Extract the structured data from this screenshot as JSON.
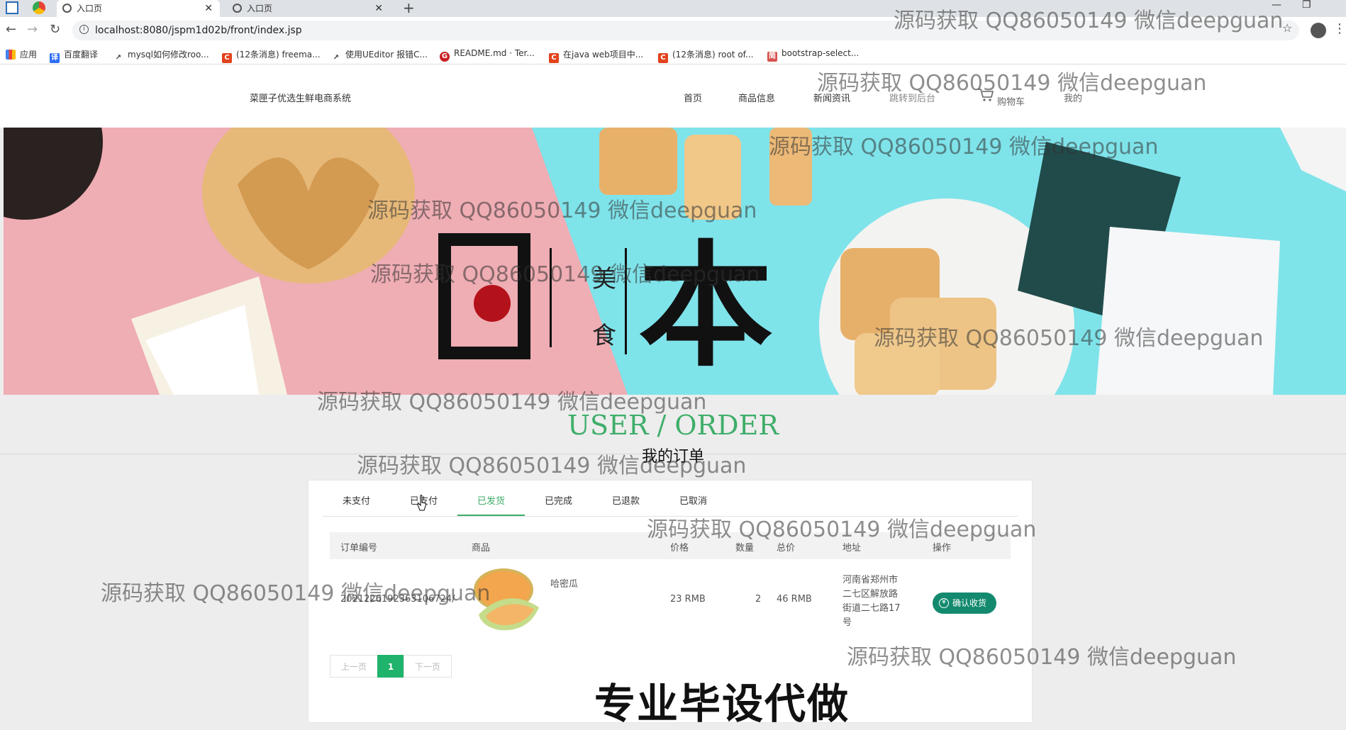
{
  "browser": {
    "tabs": [
      {
        "title": "入口页",
        "active": true
      },
      {
        "title": "入口页",
        "active": false
      }
    ],
    "url": "localhost:8080/jspm1d02b/front/index.jsp",
    "bookmarks": [
      {
        "label": "应用",
        "icon": "apps-grid-icon"
      },
      {
        "label": "百度翻译",
        "icon": "baidu-translate-icon"
      },
      {
        "label": "mysql如何修改roo...",
        "icon": "bookmark-link-icon"
      },
      {
        "label": "(12条消息) freema...",
        "icon": "csdn-icon"
      },
      {
        "label": "使用UEditor 报错C...",
        "icon": "bookmark-link-icon"
      },
      {
        "label": "README.md · Ter...",
        "icon": "gitee-icon"
      },
      {
        "label": "在java web项目中...",
        "icon": "csdn-icon"
      },
      {
        "label": "(12条消息) root of...",
        "icon": "csdn-icon"
      },
      {
        "label": "bootstrap-select...",
        "icon": "bookmark-page-icon"
      }
    ]
  },
  "site": {
    "title": "菜匣子优选生鲜电商系统",
    "nav": [
      "首页",
      "商品信息",
      "新闻资讯",
      "跳转到后台",
      "购物车",
      "我的"
    ]
  },
  "banner": {
    "big_left": "日",
    "big_right": "本",
    "small_top": "美",
    "small_bottom": "食"
  },
  "section": {
    "title_en": "USER / ORDER",
    "title_cn": "我的订单"
  },
  "order_tabs": [
    {
      "label": "未支付",
      "active": false
    },
    {
      "label": "已支付",
      "active": false
    },
    {
      "label": "已发货",
      "active": true
    },
    {
      "label": "已完成",
      "active": false
    },
    {
      "label": "已退款",
      "active": false
    },
    {
      "label": "已取消",
      "active": false
    }
  ],
  "table": {
    "headers": [
      "订单编号",
      "商品",
      "价格",
      "数量",
      "总价",
      "地址",
      "操作"
    ],
    "rows": [
      {
        "order_no": "2021226192363106724/",
        "product": "哈密瓜",
        "price": "23 RMB",
        "qty": "2",
        "total": "46 RMB",
        "address_lines": [
          "河南省郑州市",
          "二七区解放路",
          "街道二七路17",
          "号"
        ],
        "action": "确认收货"
      }
    ]
  },
  "pager": {
    "prev": "上一页",
    "current": "1",
    "next": "下一页"
  },
  "overlays": {
    "watermark": "源码获取 QQ86050149 微信deepguan",
    "promo": "专业毕设代做"
  },
  "colors": {
    "accent": "#3fae6a",
    "button": "#138a6e",
    "page_current": "#1fb36b"
  }
}
